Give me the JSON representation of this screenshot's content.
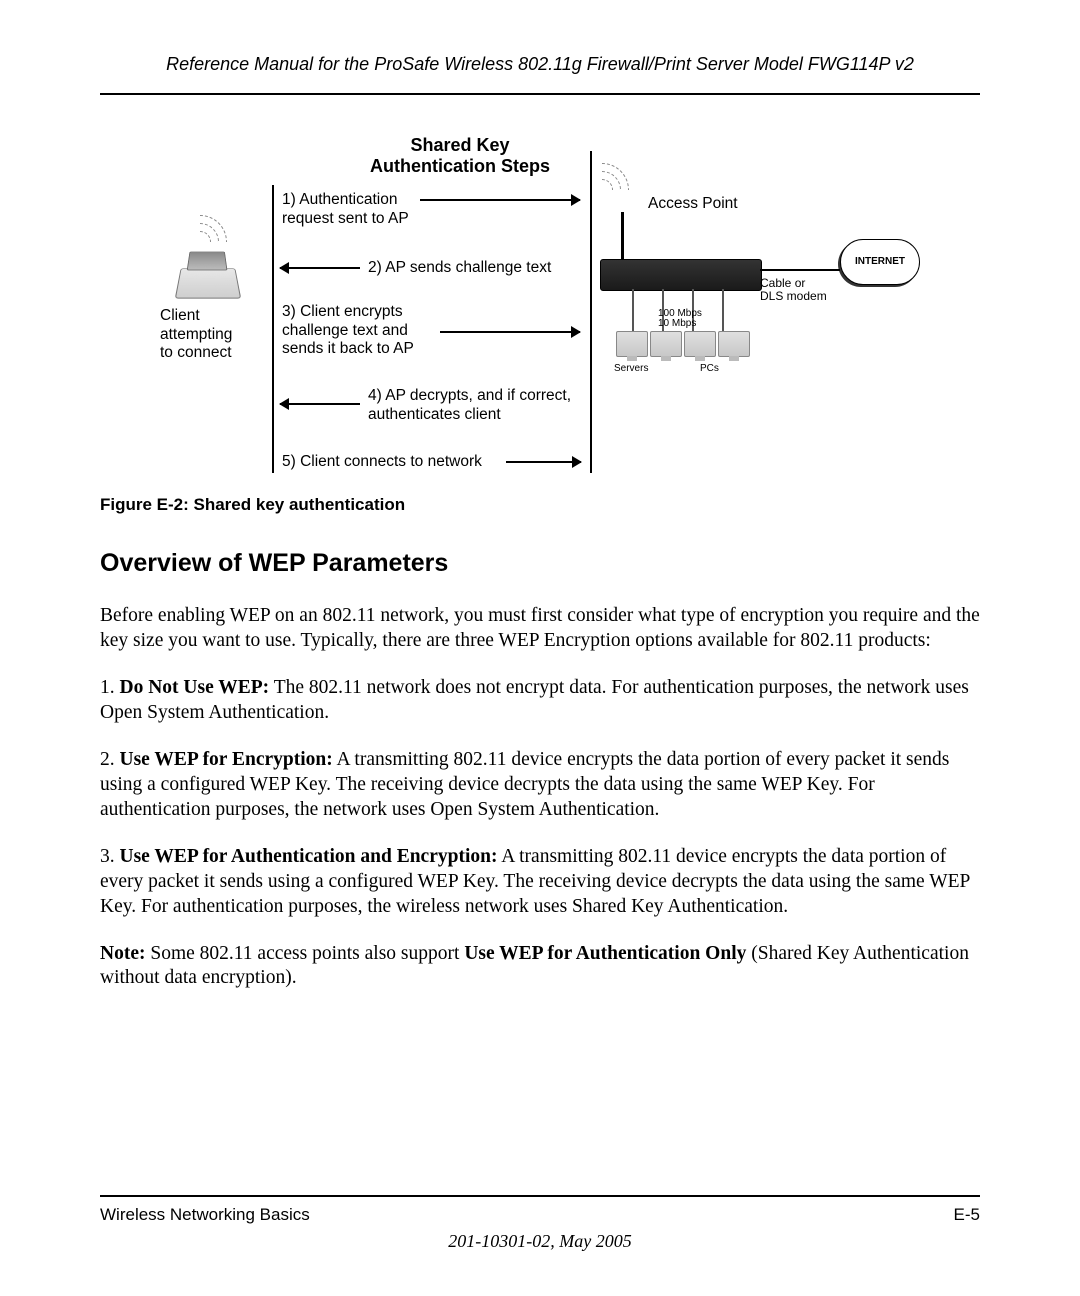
{
  "header": {
    "running_title": "Reference Manual for the ProSafe Wireless 802.11g  Firewall/Print Server Model FWG114P v2"
  },
  "figure": {
    "title_line1": "Shared Key",
    "title_line2": "Authentication Steps",
    "client_label_line1": "Client",
    "client_label_line2": "attempting",
    "client_label_line3": "to connect",
    "ap_label": "Access Point",
    "step1_line1": "1) Authentication",
    "step1_line2": "request sent to AP",
    "step2": "2) AP sends challenge text",
    "step3_line1": "3) Client encrypts",
    "step3_line2": "challenge text and",
    "step3_line3": "sends it back to AP",
    "step4_line1": "4) AP decrypts, and if correct,",
    "step4_line2": "authenticates client",
    "step5": "5) Client connects to network",
    "cable_label_line1": "Cable or",
    "cable_label_line2": "DLS modem",
    "internet_label": "INTERNET",
    "speed_label_line1": "100 Mbps",
    "speed_label_line2": "10 Mbps",
    "servers_label": "Servers",
    "pcs_label": "PCs",
    "caption": "Figure E-2:  Shared key authentication"
  },
  "section": {
    "heading": "Overview of WEP Parameters",
    "intro": "Before enabling WEP on an 802.11 network, you must first consider what type of encryption you require and the key size you want to use. Typically, there are three WEP Encryption options available for 802.11 products:",
    "opt1_bold": "Do Not Use WEP:",
    "opt1_rest": " The 802.11 network does not encrypt data. For authentication purposes, the network uses Open System Authentication.",
    "opt2_bold": "Use WEP for Encryption:",
    "opt2_rest": " A transmitting 802.11 device encrypts the data portion of every packet it sends using a configured WEP Key. The receiving device decrypts the data using the same WEP Key. For authentication purposes, the network uses Open System Authentication.",
    "opt3_bold": "Use WEP for Authentication and Encryption:",
    "opt3_rest": " A transmitting 802.11 device encrypts the data portion of every packet it sends using a configured WEP Key. The receiving device decrypts the data using the same WEP Key. For authentication purposes, the wireless network uses Shared Key Authentication.",
    "note_bold1": "Note:",
    "note_mid": " Some 802.11 access points also support ",
    "note_bold2": "Use WEP for Authentication Only",
    "note_end": " (Shared Key Authentication without data encryption)."
  },
  "footer": {
    "section_name": "Wireless Networking Basics",
    "page_number": "E-5",
    "doc_id_date": "201-10301-02, May 2005"
  }
}
